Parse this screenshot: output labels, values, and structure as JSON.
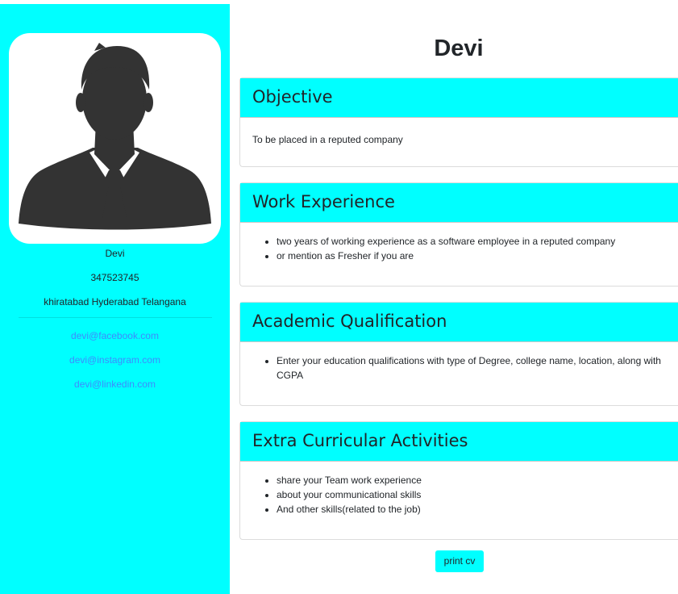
{
  "sidebar": {
    "avatar_icon": "person-silhouette-icon",
    "name": "Devi",
    "phone": "347523745",
    "address": "khiratabad Hyderabad Telangana",
    "links": [
      "devi@facebook.com",
      "devi@instagram.com",
      "devi@linkedin.com"
    ],
    "background_color": "#00ffff",
    "link_color": "#3d8bfd"
  },
  "main": {
    "title": "Devi",
    "sections": [
      {
        "heading": "Objective",
        "text": "To be placed in a reputed company"
      },
      {
        "heading": "Work Experience",
        "items": [
          "two years of working experience as a software employee in a reputed company",
          "or mention as Fresher if you are"
        ]
      },
      {
        "heading": "Academic Qualification",
        "items": [
          "Enter your education qualifications with type of Degree, college name, location, along with CGPA"
        ]
      },
      {
        "heading": "Extra Curricular Activities",
        "items": [
          "share your Team work experience",
          "about your communicational skills",
          "And other skills(related to the job)"
        ]
      }
    ],
    "print_button": "print cv",
    "header_color": "#00ffff"
  }
}
